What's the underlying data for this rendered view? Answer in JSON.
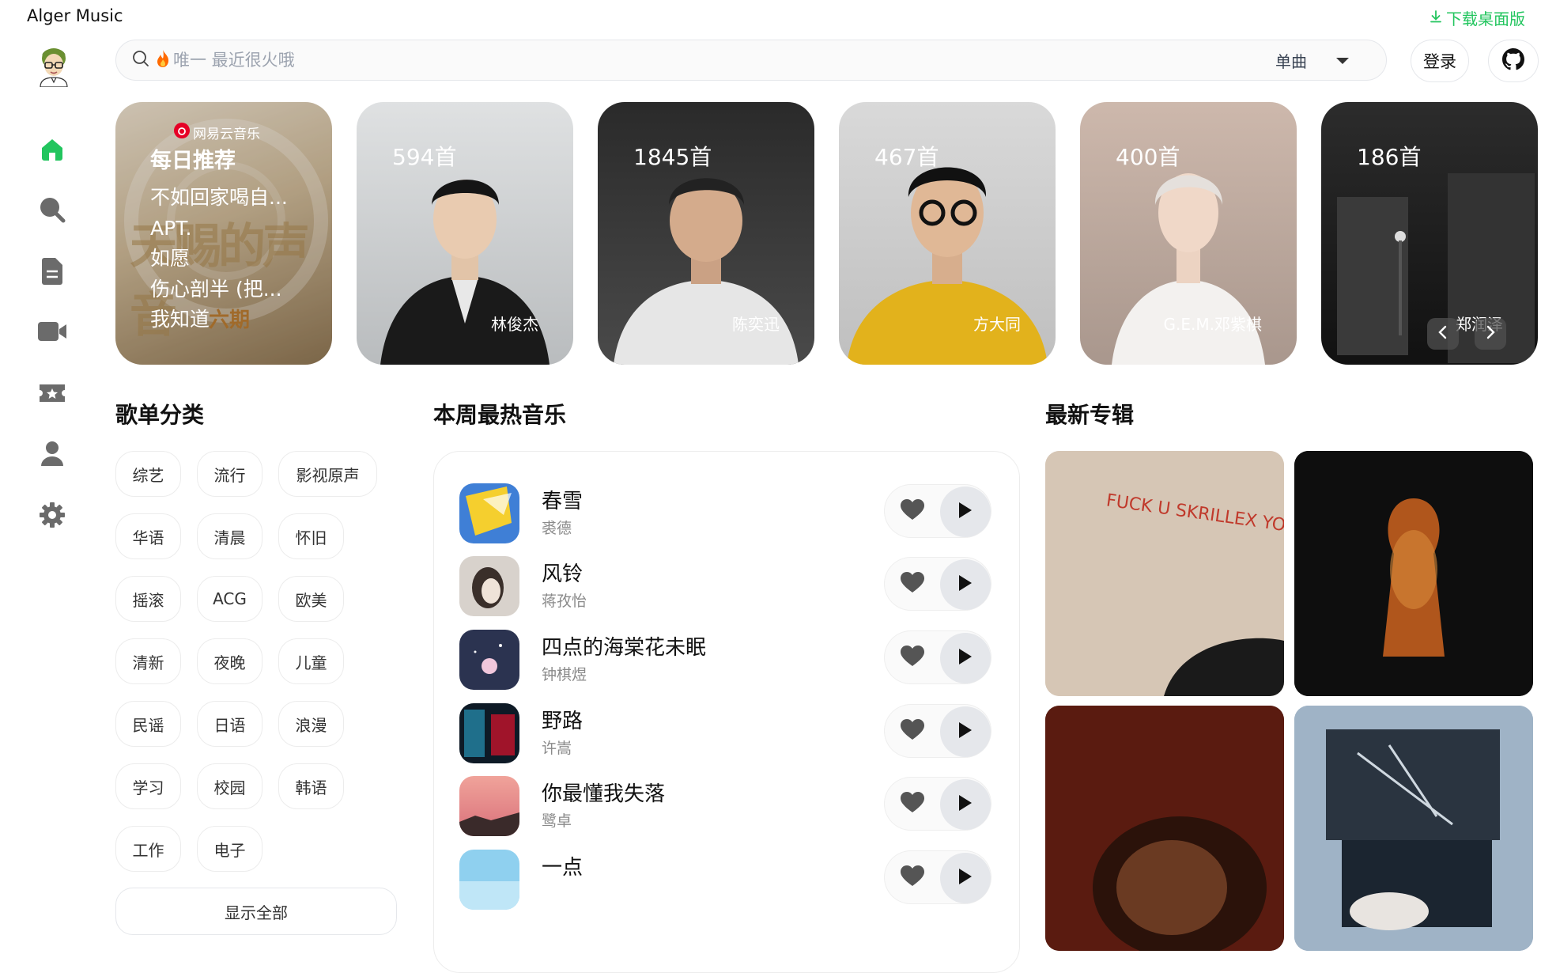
{
  "app": {
    "title": "Alger Music",
    "download_label": "下载桌面版"
  },
  "search": {
    "placeholder": "唯一 最近很火哦",
    "type_label": "单曲"
  },
  "header": {
    "login_label": "登录"
  },
  "sidebar": {
    "items": [
      {
        "name": "home",
        "icon": "home-icon"
      },
      {
        "name": "search",
        "icon": "search-icon"
      },
      {
        "name": "playlist",
        "icon": "file-icon"
      },
      {
        "name": "mv",
        "icon": "video-icon"
      },
      {
        "name": "rank",
        "icon": "ticket-icon"
      },
      {
        "name": "user",
        "icon": "user-icon"
      },
      {
        "name": "settings",
        "icon": "gear-icon"
      }
    ]
  },
  "daily": {
    "brand": "网易云音乐",
    "title": "每日推荐",
    "songs": [
      "不如回家喝自...",
      "APT.",
      "如愿",
      "伤心剖半 (把...",
      "我知道"
    ],
    "bg_text": "天赐的声音",
    "tag": "六期"
  },
  "artists": [
    {
      "count": "594首",
      "name": "林俊杰"
    },
    {
      "count": "1845首",
      "name": "陈奕迅"
    },
    {
      "count": "467首",
      "name": "方大同"
    },
    {
      "count": "400首",
      "name": "G.E.M.邓紫棋"
    },
    {
      "count": "186首",
      "name": "郑润泽"
    }
  ],
  "sections": {
    "categories_title": "歌单分类",
    "hot_title": "本周最热音乐",
    "albums_title": "最新专辑"
  },
  "categories": [
    "综艺",
    "流行",
    "影视原声",
    "华语",
    "清晨",
    "怀旧",
    "摇滚",
    "ACG",
    "欧美",
    "清新",
    "夜晚",
    "儿童",
    "民谣",
    "日语",
    "浪漫",
    "学习",
    "校园",
    "韩语",
    "工作",
    "电子"
  ],
  "show_all_label": "显示全部",
  "hot_songs": [
    {
      "name": "春雪",
      "singer": "裘德"
    },
    {
      "name": "风铃",
      "singer": "蒋孜怡"
    },
    {
      "name": "四点的海棠花未眠",
      "singer": "钟棋煜"
    },
    {
      "name": "野路",
      "singer": "许嵩"
    },
    {
      "name": "你最懂我失落",
      "singer": "鹭卓"
    },
    {
      "name": "一点",
      "singer": ""
    }
  ],
  "album_graffiti_text": "FUCK U SKRILLEX YOU THINK UR ANDY WARHOL BUT UR NOT!!",
  "colors": {
    "accent": "#22c55e",
    "icon_gray": "#6b6b6b"
  }
}
